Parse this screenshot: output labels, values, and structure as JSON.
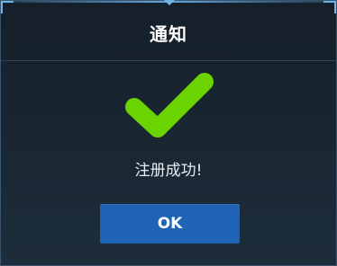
{
  "dialog": {
    "title": "通知",
    "message": "注册成功!",
    "ok_label": "OK",
    "icon": "checkmark-icon"
  },
  "colors": {
    "background": "#1b2733",
    "accent": "#6fb3e6",
    "check": "#6bd300",
    "button": "#1f63b7"
  }
}
